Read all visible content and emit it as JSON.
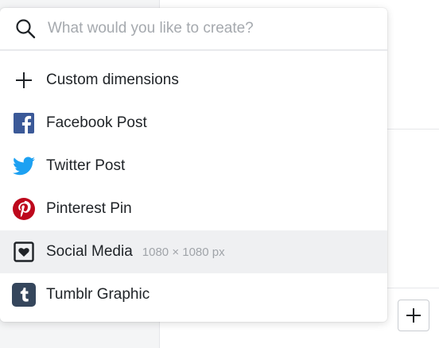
{
  "search": {
    "placeholder": "What would you like to create?",
    "icon": "search-icon"
  },
  "menu": {
    "items": [
      {
        "label": "Custom dimensions",
        "icon": "plus-icon"
      },
      {
        "label": "Facebook Post",
        "icon": "facebook-icon",
        "color": "#3b5998"
      },
      {
        "label": "Twitter Post",
        "icon": "twitter-icon",
        "color": "#1da1f2"
      },
      {
        "label": "Pinterest Pin",
        "icon": "pinterest-icon",
        "color": "#bd081c"
      },
      {
        "label": "Social Media",
        "meta": "1080 × 1080 px",
        "icon": "social-media-heart-icon",
        "highlighted": true
      },
      {
        "label": "Tumblr Graphic",
        "icon": "tumblr-icon",
        "color": "#35465c"
      }
    ]
  },
  "background": {
    "add_button_icon": "plus-icon"
  }
}
